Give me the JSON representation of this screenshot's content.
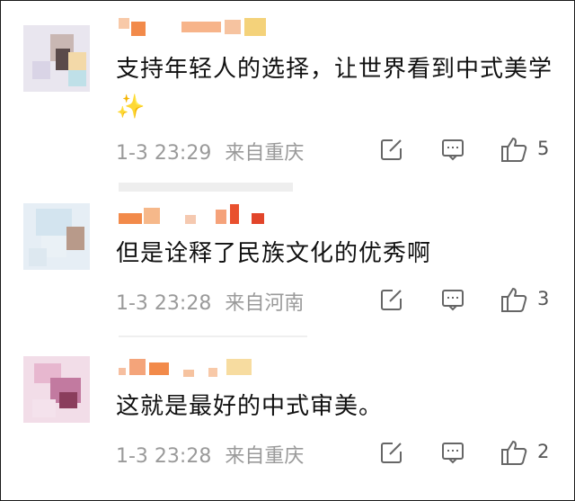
{
  "comments": [
    {
      "text": "支持年轻人的选择，让世界看到中式美学✨",
      "date": "1-3 23:29",
      "location": "来自重庆",
      "likes": "5"
    },
    {
      "text": "但是诠释了民族文化的优秀啊",
      "date": "1-3 23:28",
      "location": "来自河南",
      "likes": "3"
    },
    {
      "text": "这就是最好的中式审美。",
      "date": "1-3 23:28",
      "location": "来自重庆",
      "likes": "2"
    }
  ],
  "icons": [
    "edit-icon",
    "comment-icon",
    "thumbs-up-icon"
  ],
  "colors": {
    "text": "#111111",
    "meta": "#9a9a9a",
    "username_blur": "#f28a4a"
  }
}
